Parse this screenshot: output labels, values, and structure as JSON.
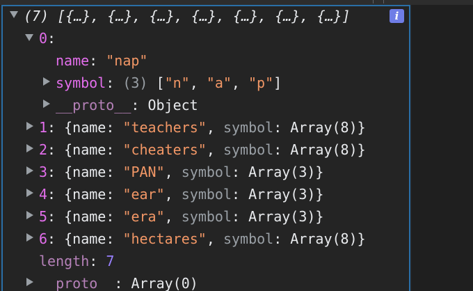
{
  "root": {
    "count": "(7)",
    "preview": "[{…}, {…}, {…}, {…}, {…}, {…}, {…}]",
    "info_icon": "i"
  },
  "item0": {
    "index": "0",
    "name_key": "name",
    "name_value": "\"nap\"",
    "symbol_key": "symbol",
    "symbol_count": "(3)",
    "symbol_open": "[",
    "symbol_values": [
      "\"n\"",
      "\"a\"",
      "\"p\""
    ],
    "symbol_close": "]",
    "proto_key": "__proto__",
    "proto_value": "Object"
  },
  "rows": [
    {
      "index": "1",
      "name_value": "\"teachers\"",
      "symbol_value": "Array(8)"
    },
    {
      "index": "2",
      "name_value": "\"cheaters\"",
      "symbol_value": "Array(8)"
    },
    {
      "index": "3",
      "name_value": "\"PAN\"",
      "symbol_value": "Array(3)"
    },
    {
      "index": "4",
      "name_value": "\"ear\"",
      "symbol_value": "Array(3)"
    },
    {
      "index": "5",
      "name_value": "\"era\"",
      "symbol_value": "Array(3)"
    },
    {
      "index": "6",
      "name_value": "\"hectares\"",
      "symbol_value": "Array(8)"
    }
  ],
  "row_labels": {
    "name_key": "name",
    "symbol_key": "symbol"
  },
  "length": {
    "key": "length",
    "value": "7"
  },
  "array_proto": {
    "key": "__proto__",
    "value": "Array(0)"
  },
  "colors": {
    "background": "#242424",
    "key": "#e36eec",
    "string": "#f29766",
    "number": "#9980ff",
    "focus_border": "#2a6fa7",
    "info_badge": "#6f7de6"
  }
}
